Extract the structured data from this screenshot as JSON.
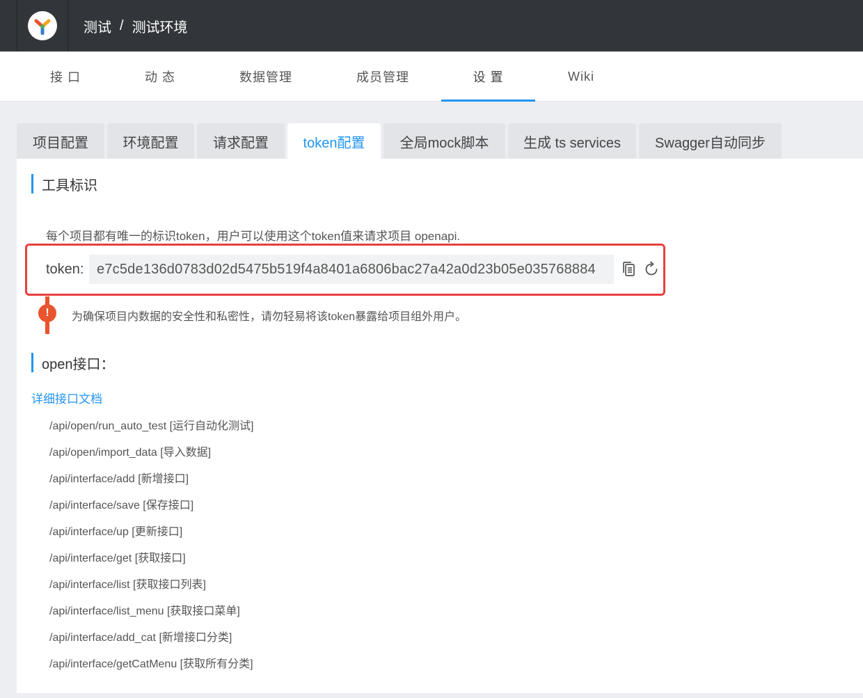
{
  "header": {
    "group": "测试",
    "separator": "/",
    "project": "测试环境"
  },
  "nav": {
    "items": [
      {
        "label": "接 口"
      },
      {
        "label": "动 态"
      },
      {
        "label": "数据管理"
      },
      {
        "label": "成员管理"
      },
      {
        "label": "设 置",
        "active": true
      },
      {
        "label": "Wiki"
      }
    ]
  },
  "tabs": [
    {
      "label": "项目配置"
    },
    {
      "label": "环境配置"
    },
    {
      "label": "请求配置"
    },
    {
      "label": "token配置",
      "active": true
    },
    {
      "label": "全局mock脚本"
    },
    {
      "label": "生成 ts services"
    },
    {
      "label": "Swagger自动同步"
    }
  ],
  "token_section": {
    "title": "工具标识",
    "description": "每个项目都有唯一的标识token，用户可以使用这个token值来请求项目 openapi.",
    "token_label": "token:",
    "token_value": "e7c5de136d0783d02d5475b519f4a8401a6806bac27a42a0d23b05e035768884",
    "copy_icon": "copy-icon",
    "refresh_icon": "refresh-icon",
    "warning": "为确保项目内数据的安全性和私密性，请勿轻易将该token暴露给项目组外用户。",
    "warning_mark": "!"
  },
  "open_section": {
    "title": "open接口：",
    "doc_link": "详细接口文档",
    "apis": [
      "/api/open/run_auto_test [运行自动化测试]",
      "/api/open/import_data [导入数据]",
      "/api/interface/add [新增接口]",
      "/api/interface/save [保存接口]",
      "/api/interface/up [更新接口]",
      "/api/interface/get [获取接口]",
      "/api/interface/list [获取接口列表]",
      "/api/interface/list_menu [获取接口菜单]",
      "/api/interface/add_cat [新增接口分类]",
      "/api/interface/getCatMenu [获取所有分类]"
    ]
  },
  "colors": {
    "topbar": "#32363a",
    "accent": "#2395f1",
    "highlight_border": "#e6403f",
    "warning": "#e8542e"
  }
}
